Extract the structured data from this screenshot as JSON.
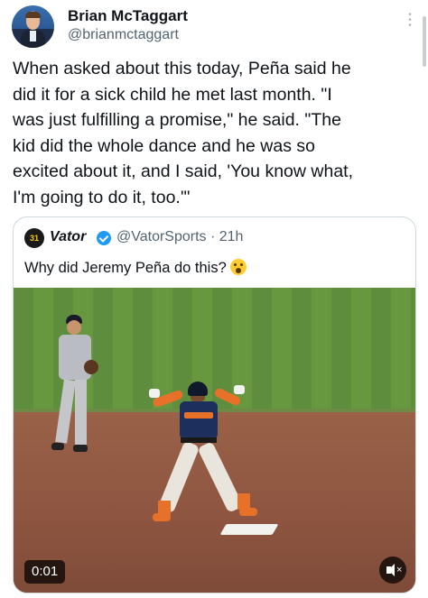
{
  "author": {
    "name": "Brian McTaggart",
    "handle": "@brianmctaggart"
  },
  "tweet": {
    "text": "When asked about this today, Peña said he\ndid it for a sick child he met last month. \"I\nwas just fulfilling a promise,\" he said. \"The\nkid did the whole dance and he was so\nexcited about it, and I said, 'You know what,\nI'm going to do it, too.'\""
  },
  "quoted": {
    "name": "Vator",
    "handle_time": "@VatorSports · 21h",
    "avatar_label": "31",
    "text": "Why did Jeremy Peña do this?",
    "emoji": "astonished-face-emoji"
  },
  "video": {
    "timestamp": "0:01",
    "mute_icon": "speaker-muted-icon"
  },
  "colors": {
    "verified": "#1d9bf0",
    "handle_gray": "#536471",
    "border": "#cfd9de"
  }
}
